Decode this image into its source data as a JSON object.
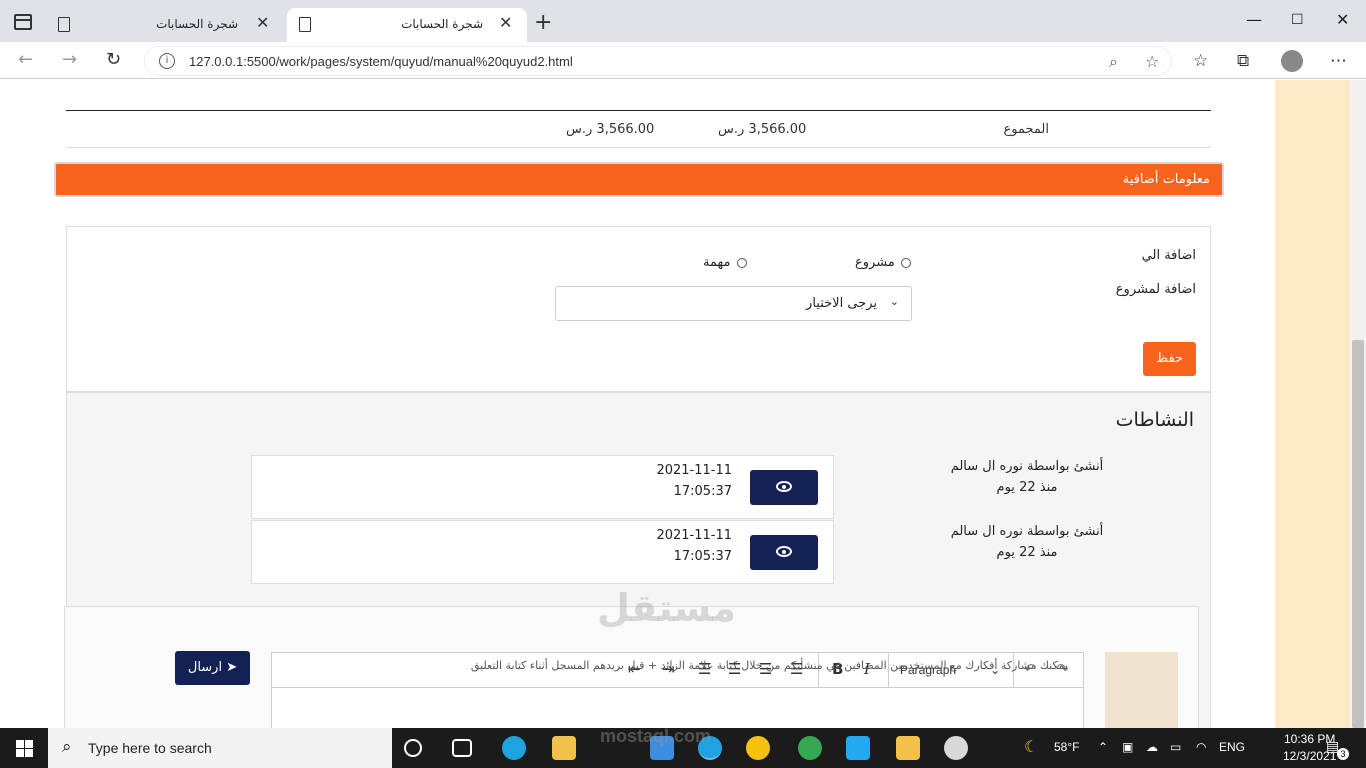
{
  "browser": {
    "tabs": [
      {
        "title": "شجرة الحسابات",
        "active": false
      },
      {
        "title": "شجرة الحسابات",
        "active": true
      }
    ],
    "url": "127.0.0.1:5500/work/pages/system/quyud/manual%20quyud2.html"
  },
  "totals": {
    "label": "المجموع",
    "debit": "3,566.00 ر.س",
    "credit": "3,566.00 ر.س"
  },
  "extra_info": {
    "header": "معلومات أضافية",
    "add_to_label": "اضافة الي",
    "add_to_project_label": "اضافة لمشروع",
    "radio_project": "مشروع",
    "radio_task": "مهمة",
    "select_placeholder": "يرجى الاختيار",
    "save_button": "حفظ"
  },
  "activities": {
    "title": "النشاطات",
    "items": [
      {
        "created_by": "أنشئ بواسطة نوره ال سالم",
        "ago": "منذ 22 يوم",
        "date": "2021-11-11",
        "time": "17:05:37"
      },
      {
        "created_by": "أنشئ بواسطة نوره ال سالم",
        "ago": "منذ 22 يوم",
        "date": "2021-11-11",
        "time": "17:05:37"
      }
    ]
  },
  "comment": {
    "paragraph_select": "Paragraph",
    "placeholder": "يمكنك مشاركة أفكارك مع المستخدمين المضافين في منشأتكم من خلال كتابة علامة الزائد + قبل بريدهم المسجل أثناء كتابة التعليق",
    "send_button": "ارسال"
  },
  "watermark": {
    "arabic": "مستقل",
    "latin": "mostaql.com"
  },
  "taskbar": {
    "search_placeholder": "Type here to search",
    "weather": "58°F",
    "language": "ENG",
    "time": "10:36 PM",
    "date": "12/3/2021",
    "notifications": "3"
  },
  "colors": {
    "accent": "#f7631c",
    "navy": "#132155",
    "side_panel": "#fde8c7"
  }
}
